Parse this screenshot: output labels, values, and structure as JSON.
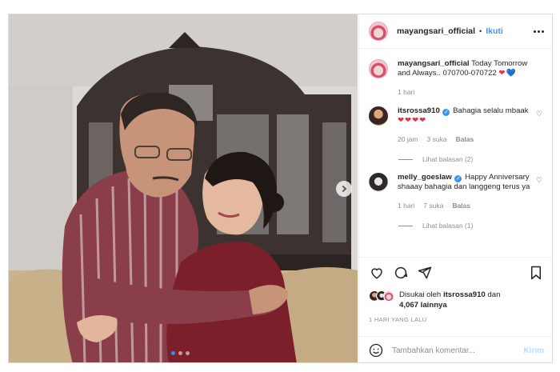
{
  "post": {
    "username": "mayangsari_official",
    "separator": "•",
    "follow_label": "Ikuti",
    "caption": "Today Tomorrow and Always.. 070700-070722",
    "caption_hearts": "❤",
    "caption_heart_blue": "💙",
    "caption_time": "1 hari"
  },
  "comments": [
    {
      "username": "itsrossa910",
      "text": "Bahagia selalu mbaak",
      "hearts": "❤❤❤❤",
      "time": "20 jam",
      "likes": "3 suka",
      "reply_label": "Balas",
      "view_replies": "Lihat balasan (2)"
    },
    {
      "username": "melly_goeslaw",
      "text": "Happy Anniversary shaaay bahagia dan langgeng terus ya",
      "time": "1 hari",
      "likes": "7 suka",
      "reply_label": "Balas",
      "view_replies": "Lihat balasan (1)"
    }
  ],
  "likes": {
    "prefix": "Disukai oleh",
    "user": "itsrossa910",
    "connector": "dan",
    "others": "4,067 lainnya"
  },
  "timestamp": "1 HARI YANG LALU",
  "add_comment": {
    "placeholder": "Tambahkan komentar...",
    "post_label": "Kirim"
  },
  "carousel": {
    "slides": 3,
    "active": 1
  },
  "icons": [
    "more-options-icon",
    "heart-icon",
    "comment-icon",
    "share-icon",
    "save-icon",
    "emoji-icon",
    "verified-badge-icon",
    "carousel-next-icon"
  ],
  "colors": {
    "link_blue": "#3897f0",
    "heart_red": "#ed2c3f",
    "muted": "#8e8e8e"
  }
}
